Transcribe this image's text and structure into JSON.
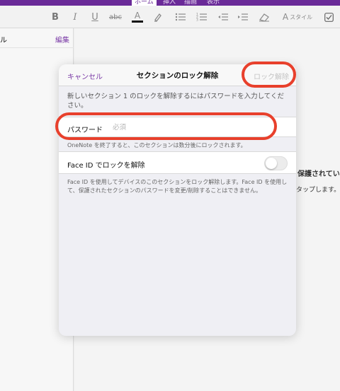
{
  "ribbon": {
    "tabs": [
      "ホーム",
      "挿入",
      "描画",
      "表示"
    ],
    "style_label": "スタイル"
  },
  "sidebar": {
    "partial_title": "ル",
    "edit_label": "編集"
  },
  "background": {
    "partial_line1": "保護されていま",
    "partial_line2": "タップします。"
  },
  "dialog": {
    "cancel_label": "キャンセル",
    "title": "セクションのロック解除",
    "unlock_label": "ロック解除",
    "description": "新しいセクション 1 のロックを解除するにはパスワードを入力してください。",
    "password_label": "パスワード",
    "password_placeholder": "必須",
    "password_value": "",
    "autolock_note": "OneNote を終了すると、このセクションは数分後にロックされます。",
    "faceid_label": "Face ID でロックを解除",
    "faceid_enabled": false,
    "faceid_note": "Face ID を使用してデバイスのこのセクションをロック解除します。Face ID を使用して、保護されたセクションのパスワードを変更/削除することはできません。"
  },
  "colors": {
    "accent_purple": "#7a3aa6",
    "title_bar_purple": "#6a2a98",
    "annotation_red": "#e8402c",
    "disabled_gray": "#c3c3c3"
  }
}
